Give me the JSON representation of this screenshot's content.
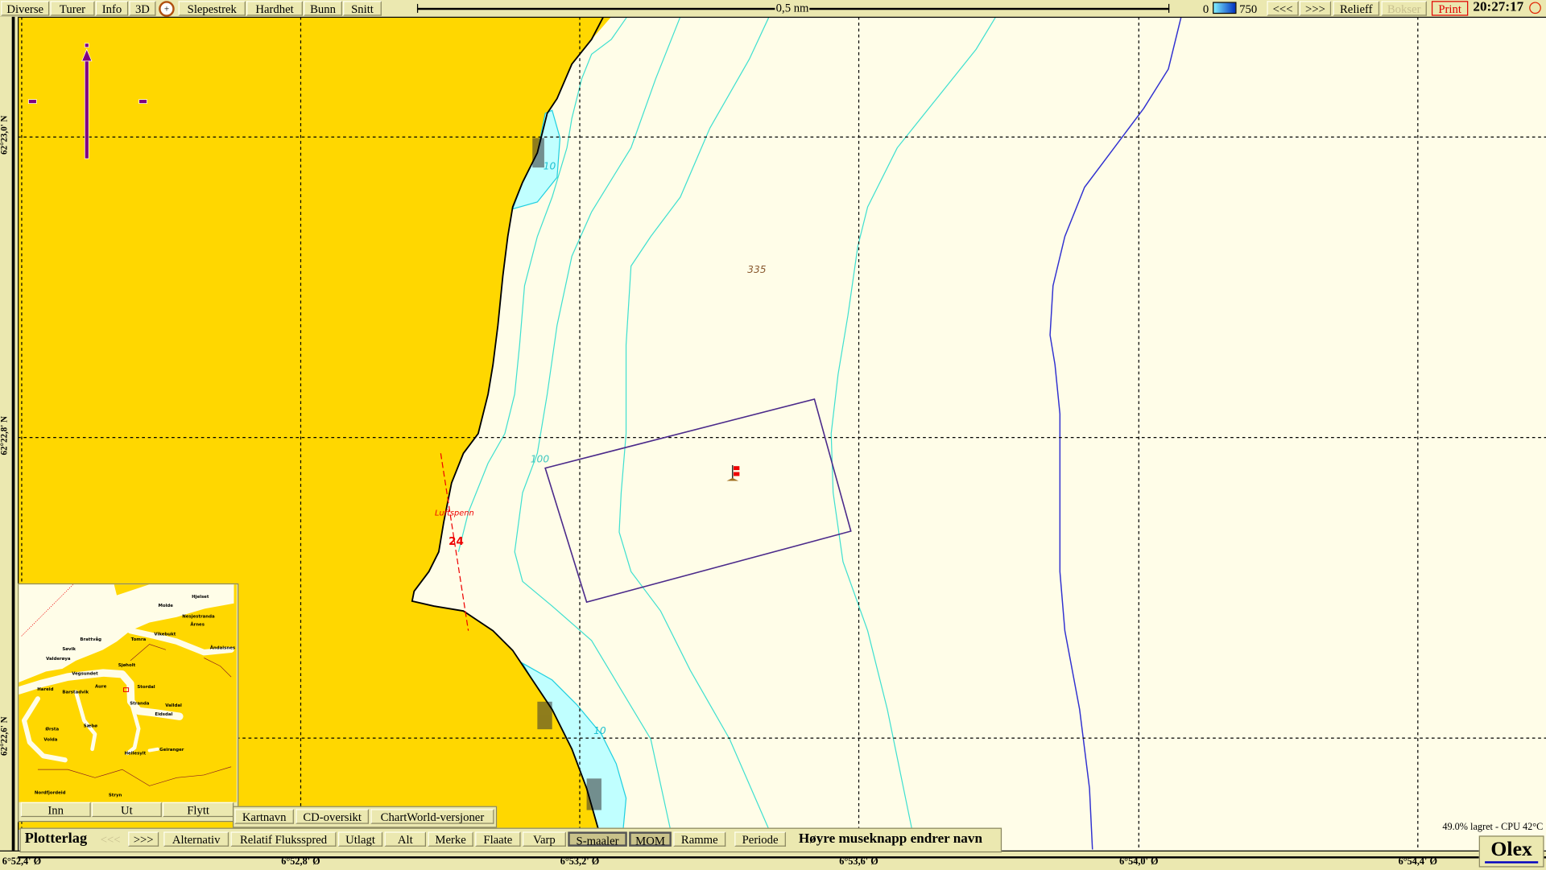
{
  "toolbar": {
    "buttons": [
      "Diverse",
      "Turer",
      "Info",
      "3D",
      "Slepestrek",
      "Hardhet",
      "Bunn",
      "Snitt"
    ],
    "scale_label": "0,5 nm",
    "depth_min": "0",
    "depth_max": "750",
    "prev": "<<<",
    "next": ">>>",
    "relieff": "Relieff",
    "bokser": "Bokser",
    "print": "Print",
    "time": "20:27:17",
    "icons": {
      "compass": "compass-icon",
      "sun": "sun-icon"
    }
  },
  "map": {
    "lat_labels": [
      "62°23,0' N",
      "62°22,8' N",
      "62°22,6' N"
    ],
    "lon_labels": [
      "6°52,4' Ø",
      "6°52,8' Ø",
      "6°53,2' Ø",
      "6°53,6' Ø",
      "6°54,0' Ø",
      "6°54,4' Ø"
    ],
    "depths": {
      "d335": "335",
      "d100": "100",
      "d10a": "10",
      "d10b": "10"
    },
    "cable_label": "Luftspenn",
    "cable_number": "24",
    "colors": {
      "land": "#ffd700",
      "sea": "#fffde8",
      "shallow": "#c0ffff",
      "contour": "#40e0d0",
      "deep_contour": "#3030d0",
      "box": "#4b2a8a"
    }
  },
  "overview": {
    "places": [
      "Hjelset",
      "Molde",
      "Nesjestranda",
      "Årnes",
      "Vikebukt",
      "Tomra",
      "Åndalsnes",
      "Brattvåg",
      "Søvik",
      "Valderøya",
      "Sjøholt",
      "Vegsundet",
      "Hareid",
      "Barstadvik",
      "Aure",
      "Stordal",
      "Stranda",
      "Valldal",
      "Eidsdal",
      "Ørsta",
      "Volda",
      "Sæbø",
      "Hellesylt",
      "Geiranger",
      "Nordfjordeid",
      "Stryn"
    ],
    "buttons": {
      "inn": "Inn",
      "ut": "Ut",
      "flytt": "Flytt"
    }
  },
  "chart_menu": [
    "Kartnavn",
    "CD-oversikt",
    "ChartWorld-versjoner"
  ],
  "plotter": {
    "title": "Plotterlag",
    "prev": "<<<",
    "next": ">>>",
    "items": [
      "Alternativ",
      "Relatif Fluksspred",
      "Utlagt",
      "Alt",
      "Merke",
      "Flaate",
      "Varp",
      "S-maaler",
      "MOM",
      "Ramme",
      "Periode"
    ],
    "hint": "Høyre museknapp endrer navn"
  },
  "status": "49.0% lagret - CPU 42°C",
  "logo": "Olex"
}
